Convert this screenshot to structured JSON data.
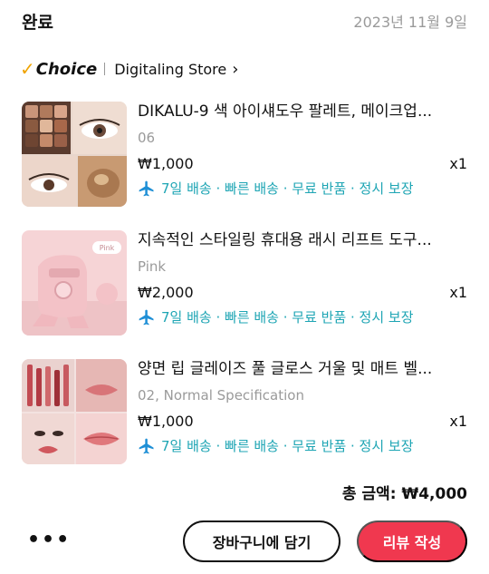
{
  "order": {
    "status": "완료",
    "date": "2023년 11월 9일"
  },
  "store": {
    "badge": "Choice",
    "name": "Digitaling Store",
    "chevron_icon": "chevron-right-icon"
  },
  "items": [
    {
      "title": "DIKALU-9 색 아이섀도우 팔레트, 메이크업...",
      "variant": "06",
      "price": "₩1,000",
      "qty": "x1",
      "shipping": "7일 배송 · 빠른 배송 · 무료 반품 · 정시 보장"
    },
    {
      "title": "지속적인 스타일링 휴대용 래시 리프트 도구...",
      "variant": "Pink",
      "price": "₩2,000",
      "qty": "x1",
      "shipping": "7일 배송 · 빠른 배송 · 무료 반품 · 정시 보장",
      "thumb_label": "Pink"
    },
    {
      "title": "양면 립 글레이즈 풀 글로스 거울 및 매트 벨...",
      "variant": "02, Normal Specification",
      "price": "₩1,000",
      "qty": "x1",
      "shipping": "7일 배송 · 빠른 배송 · 무료 반품 · 정시 보장"
    }
  ],
  "total": "총 금액: ₩4,000",
  "actions": {
    "more": "•••",
    "add_to_cart": "장바구니에 담기",
    "write_review": "리뷰 작성"
  },
  "colors": {
    "accent_red": "#f0384f",
    "shipping_teal": "#1ea5b4",
    "choice_gold": "#f0a400"
  }
}
